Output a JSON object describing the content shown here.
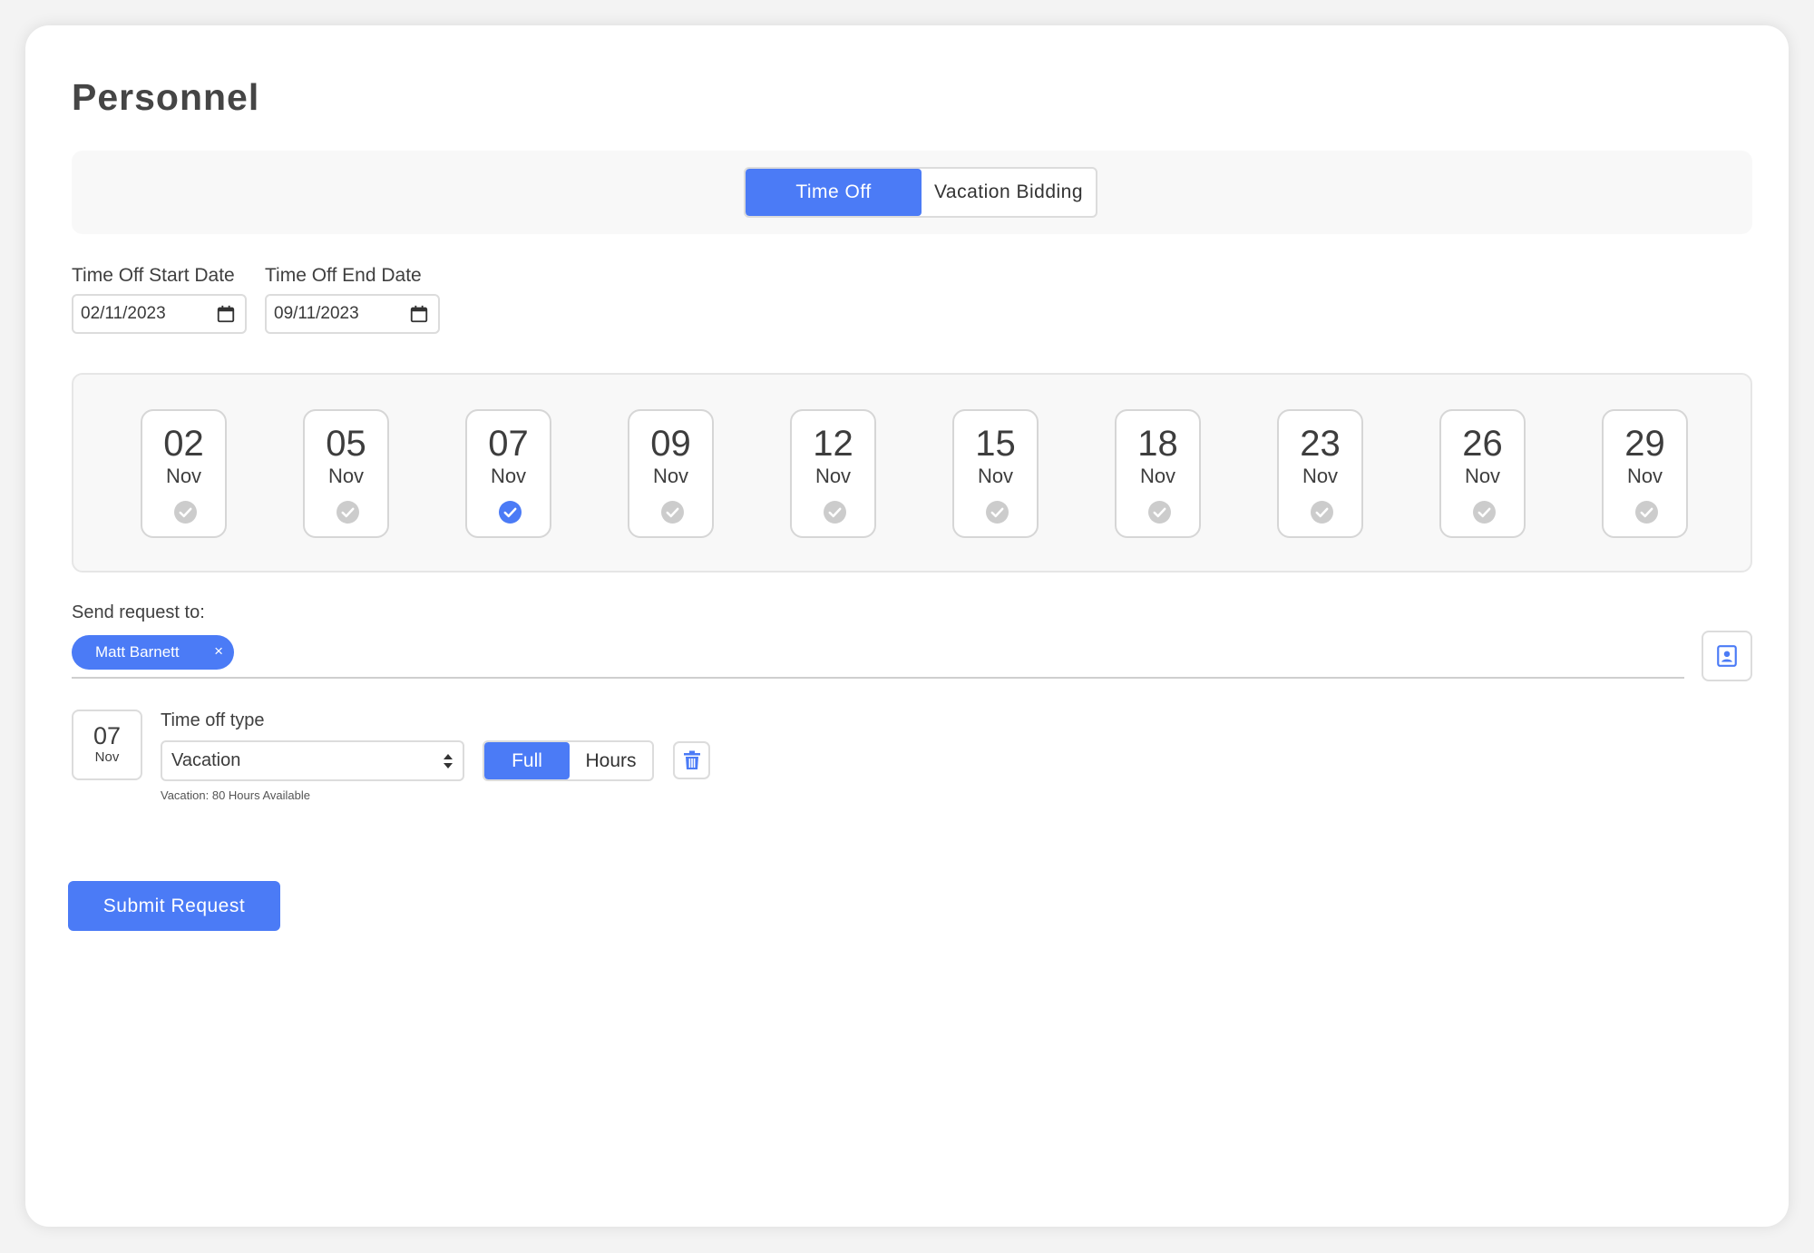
{
  "page": {
    "title": "Personnel"
  },
  "tabs": [
    {
      "label": "Time Off",
      "active": true
    },
    {
      "label": "Vacation Bidding",
      "active": false
    }
  ],
  "dates": {
    "start_label": "Time Off Start Date",
    "start_value": "02/11/2023",
    "end_label": "Time Off End Date",
    "end_value": "09/11/2023",
    "icon": "calendar-icon"
  },
  "days": [
    {
      "day": "02",
      "month": "Nov",
      "selected": false
    },
    {
      "day": "05",
      "month": "Nov",
      "selected": false
    },
    {
      "day": "07",
      "month": "Nov",
      "selected": true
    },
    {
      "day": "09",
      "month": "Nov",
      "selected": false
    },
    {
      "day": "12",
      "month": "Nov",
      "selected": false
    },
    {
      "day": "15",
      "month": "Nov",
      "selected": false
    },
    {
      "day": "18",
      "month": "Nov",
      "selected": false
    },
    {
      "day": "23",
      "month": "Nov",
      "selected": false
    },
    {
      "day": "26",
      "month": "Nov",
      "selected": false
    },
    {
      "day": "29",
      "month": "Nov",
      "selected": false
    }
  ],
  "send_request": {
    "label": "Send request to:",
    "recipients": [
      {
        "name": "Matt Barnett",
        "remove_glyph": "×"
      }
    ],
    "contact_icon": "contact-book-icon"
  },
  "entry": {
    "day": "07",
    "month": "Nov",
    "type_label": "Time off type",
    "type_value": "Vacation",
    "availability": "Vacation: 80 Hours Available",
    "duration_options": [
      "Full",
      "Hours"
    ],
    "duration_selected": "Full",
    "delete_icon": "trash-icon"
  },
  "actions": {
    "submit_label": "Submit Request"
  },
  "colors": {
    "accent": "#4b7bf6",
    "check_inactive": "#cccccc",
    "border": "#dcdcdc"
  }
}
